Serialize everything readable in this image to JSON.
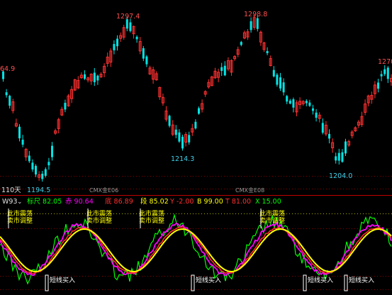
{
  "colors": {
    "background": "#000000",
    "up_candle": "#ff3030",
    "down_candle": "#00e5e5",
    "label_red": "#ff5050",
    "label_cyan": "#40d0e8",
    "grid_dotted": "#8a0000",
    "separator": "#c00000",
    "line_yellow": "#ffff00",
    "line_magenta": "#ff00ff",
    "line_green": "#00ff00",
    "line_red": "#ff2a2a",
    "contract_label": "#9a9a9a"
  },
  "price_labels": {
    "left_partial": "64.9",
    "peak_1": "1297.4",
    "peak_2": "1298.8",
    "right_partial": "1270",
    "trough_1": "1194.5",
    "trough_2": "1214.3",
    "trough_3": "1204.0"
  },
  "chart_header": {
    "period": "110天",
    "contract_1": "CMX金E06",
    "contract_2": "CMX金E08"
  },
  "indicator_bar": {
    "name": "W93",
    "dropdown_glyph": "⌄",
    "items": [
      {
        "label": "标尺",
        "value": "82.05",
        "color": "#00ff00"
      },
      {
        "label": "赤",
        "value": "90.64",
        "color": "#ff00ff"
      },
      {
        "label": "底",
        "value": "86.89",
        "color": "#ff3030"
      },
      {
        "label": "段",
        "value": "85.02",
        "color": "#ffff00"
      },
      {
        "label": "Y",
        "value": "-2.00",
        "color": "#ff3030"
      },
      {
        "label": "B",
        "value": "99.00",
        "color": "#ffff00"
      },
      {
        "label": "T",
        "value": "81.00",
        "color": "#ff3030"
      },
      {
        "label": "X",
        "value": "15.00",
        "color": "#00ff00"
      }
    ]
  },
  "signals": {
    "sell_line1": "此市震荡",
    "sell_line2": "卖市调整",
    "buy": "短线买入"
  },
  "chart_data": [
    {
      "type": "candlestick",
      "title": "",
      "ylim": [
        1188,
        1305
      ],
      "annotations": [
        {
          "text": "1297.4",
          "value": 1297.4
        },
        {
          "text": "1298.8",
          "value": 1298.8
        },
        {
          "text": "1194.5",
          "value": 1194.5
        },
        {
          "text": "1214.3",
          "value": 1214.3
        },
        {
          "text": "1204.0",
          "value": 1204.0
        }
      ]
    },
    {
      "type": "line",
      "title": "W93",
      "ylim": [
        0,
        100
      ],
      "series": [
        {
          "name": "标尺",
          "last": 82.05
        },
        {
          "name": "赤",
          "last": 90.64
        },
        {
          "name": "底",
          "last": 86.89
        },
        {
          "name": "段",
          "last": 85.02
        }
      ]
    }
  ]
}
